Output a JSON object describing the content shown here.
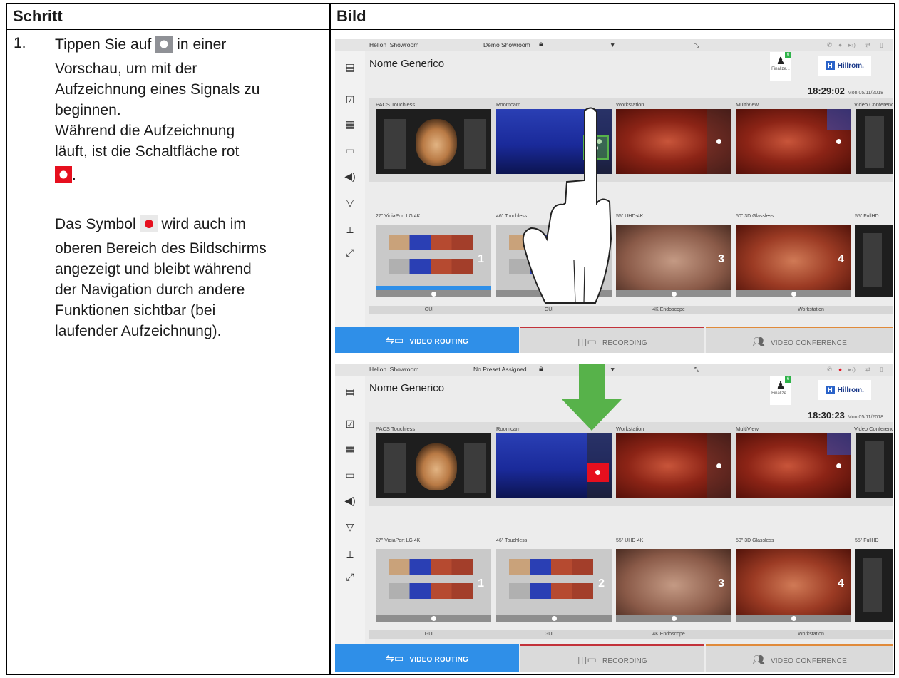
{
  "table": {
    "header_step": "Schritt",
    "header_image": "Bild",
    "step_number": "1.",
    "paragraph1": [
      "Tippen Sie auf",
      "in einer",
      "Vorschau, um mit der",
      "Aufzeichnung eines Signals zu",
      "beginnen.",
      "Während die Aufzeichnung",
      "läuft, ist die Schaltfläche rot"
    ],
    "period": ".",
    "paragraph2": [
      "Das Symbol",
      "wird auch im",
      "oberen Bereich des Bildschirms",
      "angezeigt und bleibt während",
      "der Navigation durch andere",
      "Funktionen sichtbar (bei",
      "laufender Aufzeichnung)."
    ]
  },
  "screen1": {
    "room": "Helion |Showroom",
    "preset": "Demo Showroom",
    "patient": "Nome Generico",
    "time": "18:29:02",
    "date": "Mon 05/11/2018",
    "finalize": "Finalize...",
    "badge": "6",
    "brand": "Hillrom."
  },
  "screen2": {
    "room": "Helion |Showroom",
    "preset": "No Preset Assigned",
    "patient": "Nome Generico",
    "time": "18:30:23",
    "date": "Mon 05/11/2018",
    "finalize": "Finalize...",
    "badge": "6",
    "brand": "Hillrom."
  },
  "sources": [
    "PACS Touchless",
    "Roomcam",
    "Workstation",
    "MultiView",
    "Video Conference"
  ],
  "monitors": [
    "27\" VidiaPort LG 4K",
    "46\" Touchless",
    "55\" UHD-4K",
    "50\" 3D Glassless",
    "55\" FullHD"
  ],
  "monitor_numbers": [
    "1",
    "2",
    "3",
    "4"
  ],
  "destination_strip": [
    "GUI",
    "GUI",
    "4K Endoscope",
    "Workstation"
  ],
  "tabs": [
    "VIDEO ROUTING",
    "RECORDING",
    "VIDEO CONFERENCE"
  ],
  "colors": {
    "accent_blue": "#2f8fe8",
    "record_red": "#e60f1e",
    "arrow_green": "#57b24a"
  }
}
